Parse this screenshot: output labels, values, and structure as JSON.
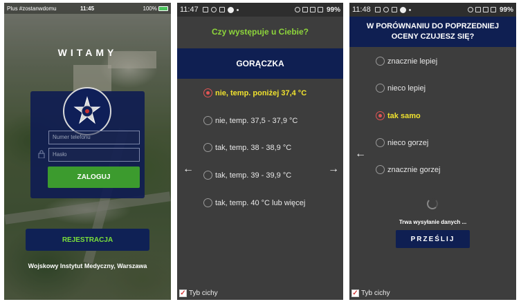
{
  "screen1": {
    "status": {
      "carrier": "Plus #zostanwdomu",
      "time": "11:45",
      "battery": "100%"
    },
    "welcome": "WITAMY",
    "phone_placeholder": "Numer telefonu",
    "password_placeholder": "Hasło",
    "login_label": "ZALOGUJ",
    "register_label": "REJESTRACJA",
    "footer": "Wojskowy Instytut Medyczny, Warszawa"
  },
  "screen2": {
    "status": {
      "time": "11:47",
      "battery": "99%"
    },
    "question": "Czy występuje u Ciebie?",
    "symptom": "GORĄCZKA",
    "options": [
      "nie, temp. poniżej 37,4 °C",
      "nie, temp. 37,5 - 37,9 °C",
      "tak, temp. 38 - 38,9 °C",
      "tak, temp. 39 - 39,9 °C",
      "tak, temp. 40 °C lub więcej"
    ],
    "selected_index": 0,
    "quiet_mode_label": "Tyb cichy"
  },
  "screen3": {
    "status": {
      "time": "11:48",
      "battery": "99%"
    },
    "title_line1": "W PORÓWNANIU DO POPRZEDNIEJ",
    "title_line2": "OCENY CZUJESZ SIĘ?",
    "options": [
      "znacznie lepiej",
      "nieco lepiej",
      "tak samo",
      "nieco gorzej",
      "znacznie gorzej"
    ],
    "selected_index": 2,
    "sending_text": "Trwa wysyłanie danych ...",
    "send_label": "PRZEŚLIJ",
    "quiet_mode_label": "Tyb cichy"
  },
  "colors": {
    "navy": "#0f1f52",
    "green": "#3c9b2e",
    "accent_green_text": "#8ed63b",
    "selected_yellow": "#f0e22e",
    "radio_red": "#e25555"
  }
}
